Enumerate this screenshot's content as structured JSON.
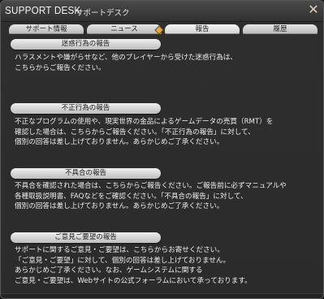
{
  "window": {
    "title": "SUPPORT DESK",
    "subtitle": "サポートデスク",
    "close_icon": "close-x-icon"
  },
  "tabs": [
    {
      "label": "サポート情報",
      "active": false
    },
    {
      "label": "ニュース",
      "active": false
    },
    {
      "label": "報告",
      "active": true
    },
    {
      "label": "履歴",
      "active": false
    }
  ],
  "sections": [
    {
      "header": "迷惑行為の報告",
      "body": "ハラスメントや嫌がらせなど、他のプレイヤーから受けた迷惑行為は、\nこちらからご報告ください。"
    },
    {
      "header": "不正行為の報告",
      "body": "不正なプログラムの使用や、現実世界の金品によるゲームデータの売買（RMT）を\n確認した場合は、こちらからご報告ください。「不正行為の報告」に対して、\n個別の回答は差し上げておりません。あらかじめご了承ください。"
    },
    {
      "header": "不具合の報告",
      "body": "不具合を確認された場合は、こちらからご報告ください。ご報告前に必ずマニュアルや\n各種取扱説明書、FAQなどをご確認ください。「不具合の報告」に対して、\n個別の回答は差し上げておりません。あらかじめご了承ください。"
    },
    {
      "header": "ご意見ご要望の報告",
      "body": "サポートに関するご意見・ご要望は、こちらからお寄せください。\n「ご意見・ご要望」に対して、個別の回答は差し上げておりません。\nあらかじめご了承ください。なお、ゲームシステムに関する\nご意見・ご要望は、Webサイトの公式フォーラムにおいて承っております。"
    }
  ]
}
